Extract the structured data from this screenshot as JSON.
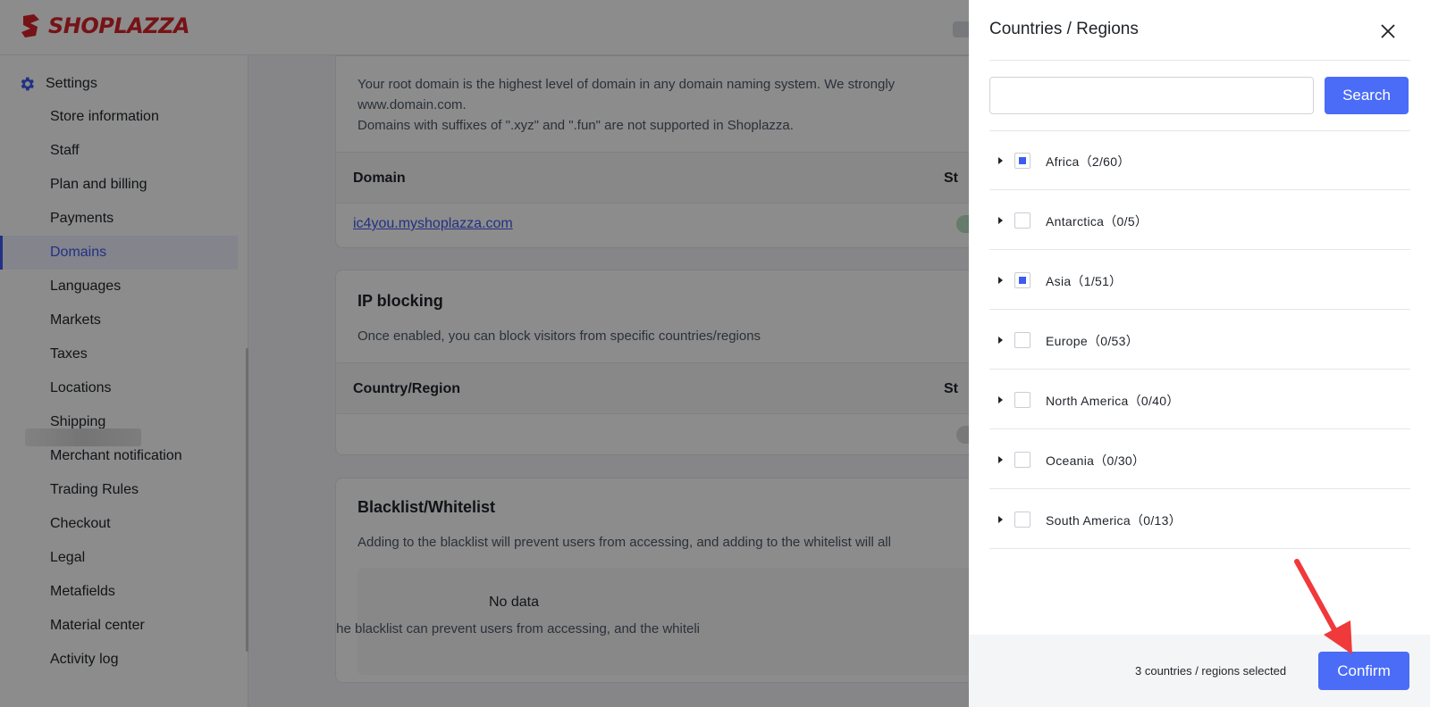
{
  "header": {
    "brand": "SHOPLAZZA"
  },
  "sidebar": {
    "title": "Settings",
    "items": [
      {
        "label": "Store information"
      },
      {
        "label": "Staff"
      },
      {
        "label": "Plan and billing"
      },
      {
        "label": "Payments"
      },
      {
        "label": "Domains"
      },
      {
        "label": "Languages"
      },
      {
        "label": "Markets"
      },
      {
        "label": "Taxes"
      },
      {
        "label": "Locations"
      },
      {
        "label": "Shipping"
      },
      {
        "label": "Merchant notification"
      },
      {
        "label": "Trading Rules"
      },
      {
        "label": "Checkout"
      },
      {
        "label": "Legal"
      },
      {
        "label": "Metafields"
      },
      {
        "label": "Material center"
      },
      {
        "label": "Activity log"
      }
    ],
    "active": "Domains"
  },
  "domains": {
    "desc_line1": "Your root domain is the highest level of domain in any domain naming system. We strongly",
    "desc_line2": "www.domain.com.",
    "desc_line3": "Domains with suffixes of \".xyz\" and \".fun\" are not supported in Shoplazza.",
    "col_domain": "Domain",
    "col_status": "St",
    "domain_link": "ic4you.myshoplazza.com"
  },
  "ip_blocking": {
    "title": "IP blocking",
    "desc": "Once enabled, you can block visitors from specific countries/regions",
    "col_country": "Country/Region",
    "col_status": "St"
  },
  "blacklist": {
    "title": "Blacklist/Whitelist",
    "desc": "Adding to the blacklist will prevent users from accessing, and adding to the whitelist will all",
    "empty_title": "No data",
    "empty_desc": "The blacklist can prevent users from accessing, and the whiteli"
  },
  "drawer": {
    "title": "Countries / Regions",
    "search_value": "",
    "search_placeholder": "",
    "search_label": "Search",
    "regions": [
      {
        "label": "Africa（2/60）",
        "state": "partial"
      },
      {
        "label": "Antarctica（0/5）",
        "state": "none"
      },
      {
        "label": "Asia（1/51）",
        "state": "partial"
      },
      {
        "label": "Europe（0/53）",
        "state": "none"
      },
      {
        "label": "North America（0/40）",
        "state": "none"
      },
      {
        "label": "Oceania（0/30）",
        "state": "none"
      },
      {
        "label": "South America（0/13）",
        "state": "none"
      }
    ],
    "selected_text": "3 countries / regions selected",
    "confirm_label": "Confirm"
  },
  "colors": {
    "accent": "#4a6cf7",
    "brand": "#d8232a",
    "annotation_arrow": "#f0393b"
  },
  "icons": [
    "shoplazza-logo-icon",
    "gear-icon",
    "close-icon",
    "caret-right-icon",
    "arrow-annotation-icon"
  ]
}
